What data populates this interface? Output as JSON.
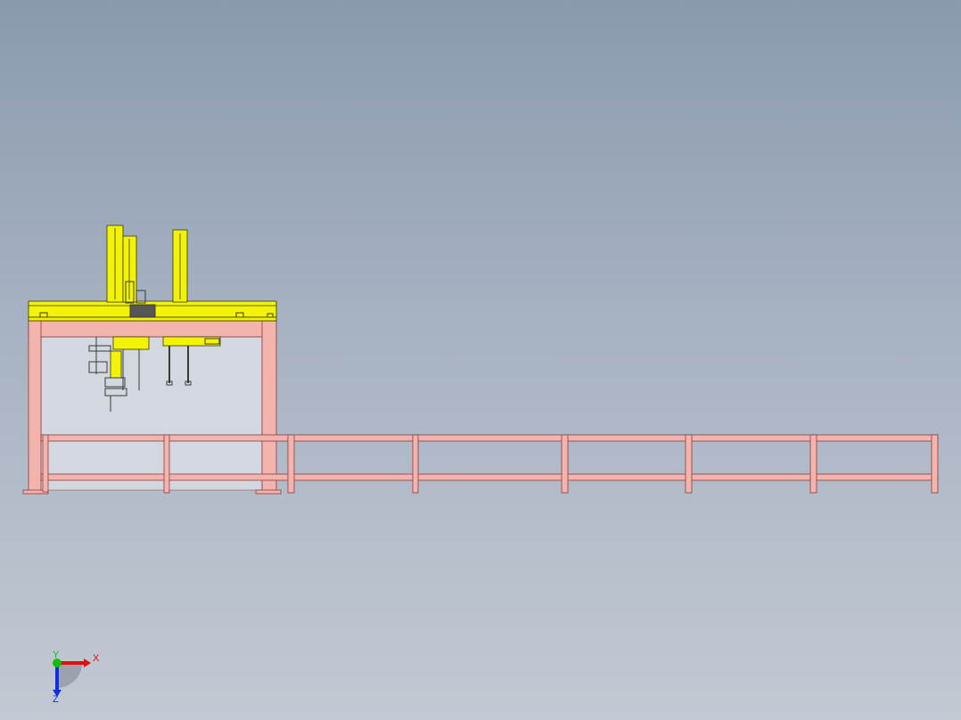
{
  "viewport": {
    "colors": {
      "frame_fill": "#f4b4ae",
      "frame_stroke": "#8a3c3c",
      "gantry_fill": "#f3f30a",
      "gantry_stroke": "#3a3a00",
      "mechanism_dark": "#3a3a3a",
      "inner_panel": "#d3d8e0"
    }
  },
  "triad": {
    "x_label": "X",
    "y_label": "Y",
    "z_label": "Z",
    "colors": {
      "x": "#e01010",
      "y": "#10c010",
      "z": "#1030e0"
    }
  }
}
